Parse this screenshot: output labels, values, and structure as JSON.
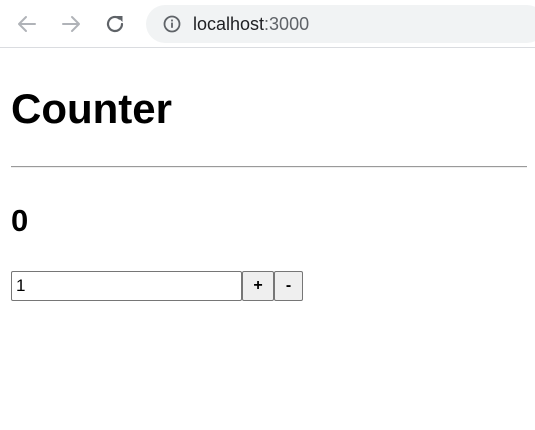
{
  "browser": {
    "url_host": "localhost",
    "url_port": ":3000"
  },
  "app": {
    "title": "Counter",
    "count": "0",
    "step_input_value": "1",
    "increment_label": "+",
    "decrement_label": "-"
  }
}
